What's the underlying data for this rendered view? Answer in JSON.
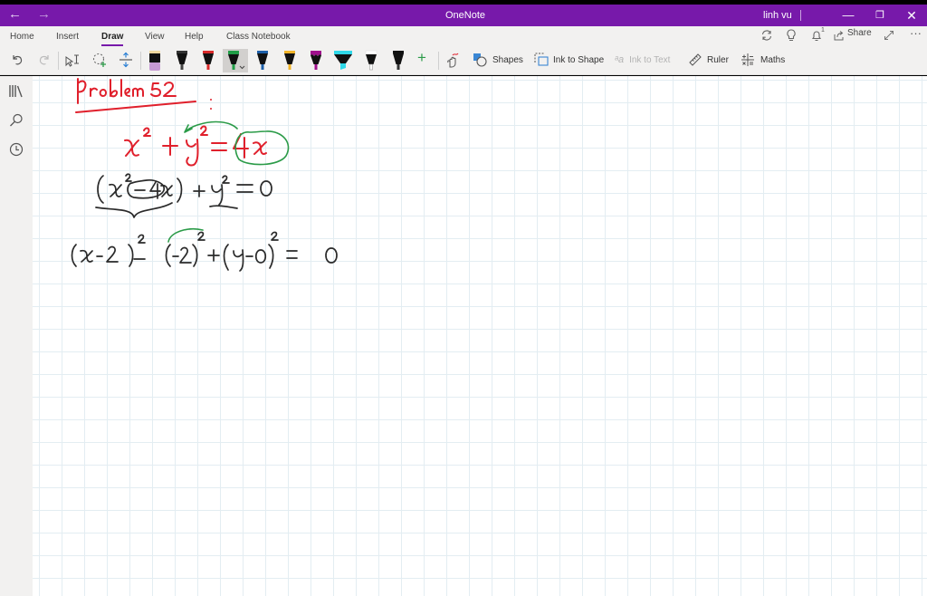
{
  "window": {
    "app_title": "OneNote",
    "user_name": "linh vu",
    "minimize": "—",
    "maximize": "❐",
    "close": "✕",
    "back_icon": "←",
    "forward_icon": "→"
  },
  "ribbon": {
    "tabs": [
      {
        "label": "Home"
      },
      {
        "label": "Insert"
      },
      {
        "label": "Draw",
        "active": true
      },
      {
        "label": "View"
      },
      {
        "label": "Help"
      },
      {
        "label": "Class Notebook"
      }
    ],
    "right_actions": {
      "sync_icon": "⟳",
      "lightbulb_icon": "💡",
      "notification_count": "1",
      "share_label": "Share",
      "expand_icon": "⤢",
      "more_icon": "···"
    },
    "tools": {
      "undo": "undo-icon",
      "redo": "redo-icon",
      "type_select": "type-select-icon",
      "lasso_select": "lasso-select-icon",
      "add_space": "add-space-icon",
      "add_pen": "+",
      "ink_replay": "ink-replay-icon",
      "shapes_label": "Shapes",
      "ink_to_shape_label": "Ink to Shape",
      "ink_to_text_label": "Ink to Text",
      "ruler_label": "Ruler",
      "maths_label": "Maths"
    },
    "pens": [
      {
        "type": "eraser",
        "color": "#c79bd4",
        "cap": "#f0d9a0"
      },
      {
        "type": "pen",
        "color": "#222222"
      },
      {
        "type": "pen",
        "color": "#d92a2a"
      },
      {
        "type": "pen",
        "color": "#1f9d46",
        "selected": true
      },
      {
        "type": "pen",
        "color": "#1d5fa8"
      },
      {
        "type": "pen",
        "color": "#f0b429"
      },
      {
        "type": "pen",
        "color": "#a0108c"
      },
      {
        "type": "highlighter",
        "color": "#2fd8e8"
      },
      {
        "type": "pen",
        "color": "#ffffff"
      },
      {
        "type": "pen",
        "color": "#111111"
      }
    ]
  },
  "sidebar": {
    "items": [
      {
        "name": "notebooks",
        "icon": "notebooks-icon"
      },
      {
        "name": "search",
        "icon": "search-icon"
      },
      {
        "name": "recent",
        "icon": "clock-icon"
      }
    ]
  },
  "page": {
    "handwriting": {
      "title": "Problem 52 :",
      "line1": "x² + y² = 4x",
      "line2": "(x² − 4x) + y² = 0",
      "line3": "(x − 2)² − (−2)² + (y − 0)² = 0"
    },
    "ink_colors": {
      "red": "#e0202c",
      "green": "#2b9b48",
      "black": "#2a2a2a"
    }
  }
}
